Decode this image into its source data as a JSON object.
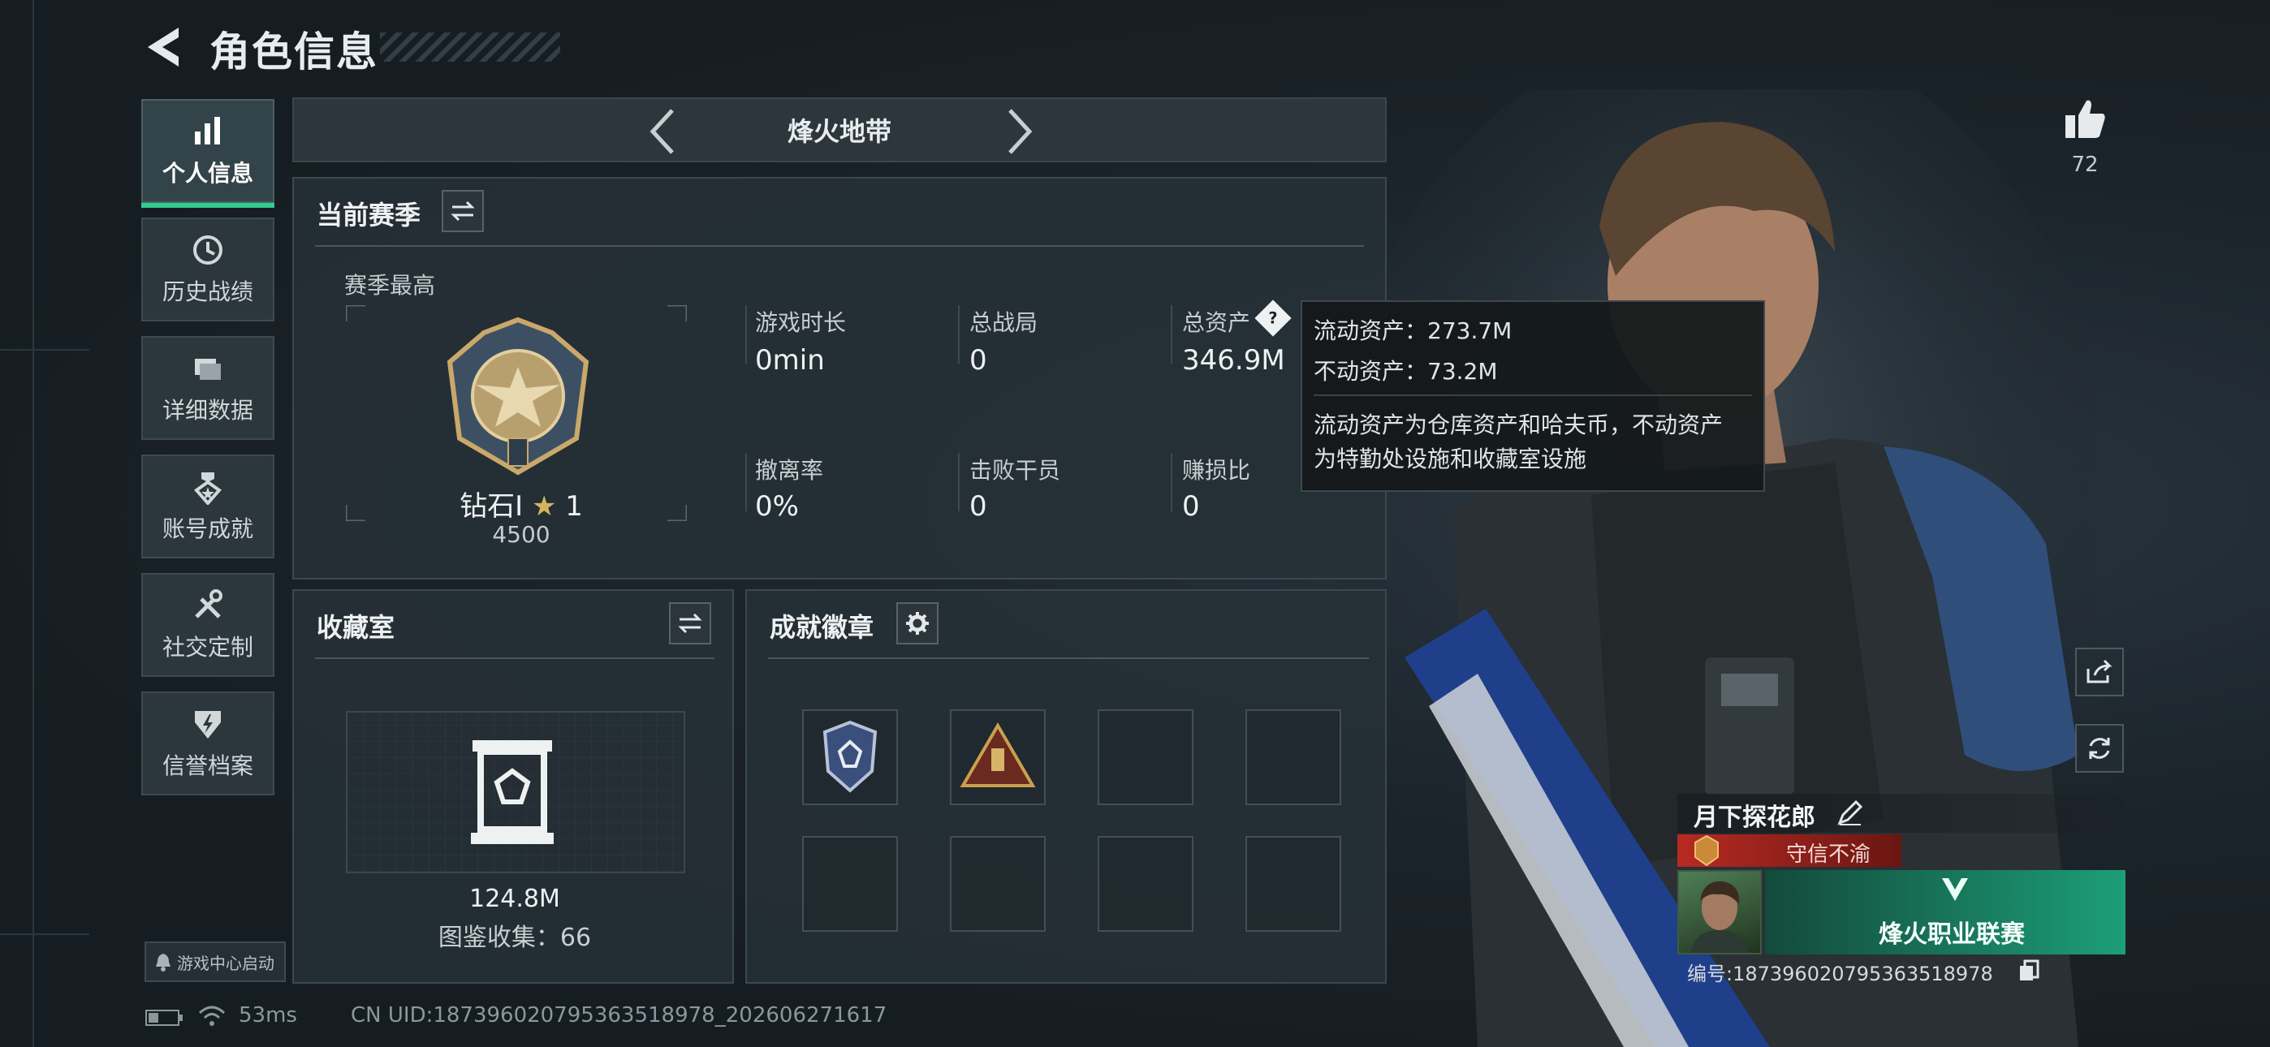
{
  "header": {
    "title": "角色信息"
  },
  "nav": [
    {
      "label": "个人信息",
      "icon": "bar-chart-icon",
      "active": true
    },
    {
      "label": "历史战绩",
      "icon": "history-icon",
      "active": false
    },
    {
      "label": "详细数据",
      "icon": "folder-icon",
      "active": false
    },
    {
      "label": "账号成就",
      "icon": "achievement-icon",
      "active": false
    },
    {
      "label": "社交定制",
      "icon": "tools-icon",
      "active": false
    },
    {
      "label": "信誉档案",
      "icon": "credit-icon",
      "active": false
    }
  ],
  "game_center": "游戏中心启动",
  "season_selector": {
    "name": "烽火地带"
  },
  "current_season": {
    "title": "当前赛季",
    "best_label": "赛季最高",
    "rank_name": "钻石I",
    "rank_stars": "1",
    "rank_points": "4500",
    "stats": [
      {
        "label": "游戏时长",
        "value": "0min"
      },
      {
        "label": "总战局",
        "value": "0"
      },
      {
        "label": "总资产",
        "value": "346.9M"
      },
      {
        "label": "撤离率",
        "value": "0%"
      },
      {
        "label": "击败干员",
        "value": "0"
      },
      {
        "label": "赚损比",
        "value": "0"
      }
    ]
  },
  "tooltip": {
    "liquid_label": "流动资产：",
    "liquid_value": "273.7M",
    "fixed_label": "不动资产：",
    "fixed_value": "73.2M",
    "note_line1": "流动资产为仓库资产和哈夫币，不动资产",
    "note_line2": "为特勤处设施和收藏室设施"
  },
  "collection": {
    "title": "收藏室",
    "value": "124.8M",
    "catalog": "图鉴收集：66"
  },
  "badges": {
    "title": "成就徽章"
  },
  "likes": {
    "count": "72"
  },
  "player": {
    "name": "月下探花郎",
    "title": "守信不渝",
    "banner_text": "烽火职业联赛",
    "id_text": "编号:1873960207953635189​78"
  },
  "footer": {
    "ping": "53ms",
    "uid": "CN UID:1873960207953635189​78_202606271617"
  },
  "colors": {
    "accent": "#2fcf8e",
    "title_red": "#8b1e1e",
    "banner_green": "#1d9e78"
  }
}
